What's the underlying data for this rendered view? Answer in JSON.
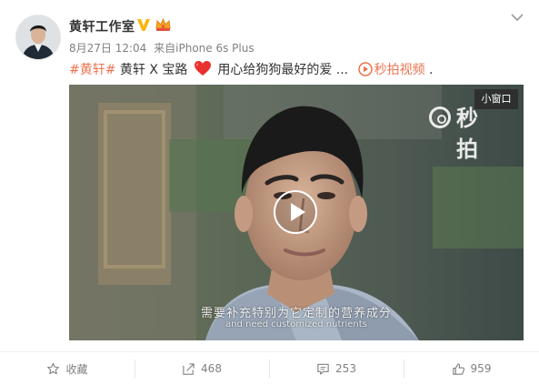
{
  "post": {
    "author": "黄轩工作室",
    "timestamp": "8月27日 12:04",
    "source_prefix": "来自",
    "source": "iPhone 6s Plus",
    "hashtag": "#黄轩#",
    "text_main": " 黄轩 X 宝路",
    "text_tail": " 用心给狗狗最好的爱 ...",
    "link_label": "秒拍视频",
    "text_end": " ."
  },
  "video": {
    "mini_window_label": "小窗口",
    "watermark": "秒拍",
    "subtitle_cn": "需要补充特别为它定制的营养成分",
    "subtitle_en": "and need customized nutrients"
  },
  "actions": {
    "favorite_label": "收藏",
    "repost_count": "468",
    "comment_count": "253",
    "like_count": "959"
  },
  "colors": {
    "link": "#eb7350",
    "verified": "#ffb400",
    "meta": "#808080"
  },
  "icons": [
    "verified-v-icon",
    "crown-badge-icon",
    "chevron-down-icon",
    "heart-emoji-icon",
    "video-link-icon",
    "play-icon",
    "star-icon",
    "repost-icon",
    "comment-icon",
    "like-icon"
  ]
}
